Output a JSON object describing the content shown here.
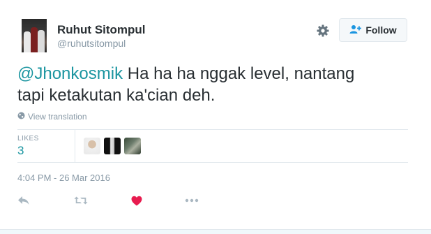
{
  "user": {
    "name": "Ruhut Sitompul",
    "handle": "@ruhutsitompul",
    "avatar_icon": "profile-photo"
  },
  "header": {
    "settings_icon": "gear-icon",
    "follow_label": "Follow",
    "follow_icon": "add-user-icon"
  },
  "tweet": {
    "mention": "@Jhonkosmik",
    "text_line1": " Ha ha ha nggak level, nantang",
    "text_line2": "tapi ketakutan ka'cian deh."
  },
  "translate": {
    "label": "View translation",
    "icon": "globe-icon"
  },
  "stats": {
    "likes_label": "LIKES",
    "likes_count": "3"
  },
  "timestamp": "4:04 PM - 26 Mar 2016",
  "actions": [
    "reply-icon",
    "retweet-icon",
    "heart-icon",
    "more-icon"
  ],
  "colors": {
    "accent": "#1b95a0",
    "like": "#e81c4f",
    "muted": "#8899a6",
    "text": "#292f33"
  }
}
